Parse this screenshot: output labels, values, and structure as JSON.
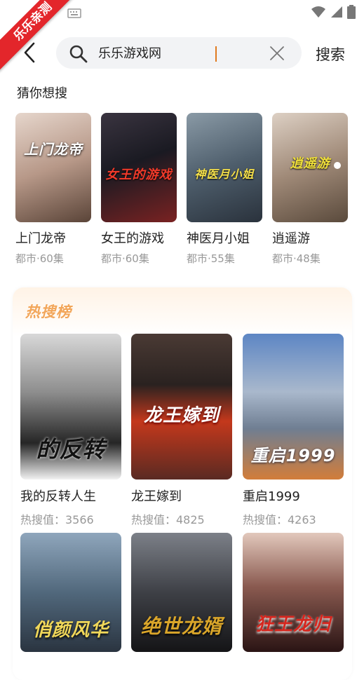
{
  "statusbar": {
    "ribbon_text": "乐乐亲测"
  },
  "search": {
    "value": "乐乐游戏网",
    "button_label": "搜索"
  },
  "guess": {
    "title": "猜你想搜",
    "items": [
      {
        "name": "上门龙帝",
        "meta": "都市·60集",
        "poster_text": "上门龙帝",
        "colors": [
          "#d9c8c0",
          "#7a5a4a"
        ]
      },
      {
        "name": "女王的游戏",
        "meta": "都市·60集",
        "poster_text": "女王的游戏",
        "colors": [
          "#1f1f2a",
          "#8a2a2a"
        ]
      },
      {
        "name": "神医月小姐",
        "meta": "都市·55集",
        "poster_text": "神医月小姐",
        "colors": [
          "#5c6e7c",
          "#2b3540"
        ]
      },
      {
        "name": "逍遥游",
        "meta": "都市·48集",
        "poster_text": "逍遥游",
        "colors": [
          "#c8b8a8",
          "#6d5a4a"
        ]
      }
    ]
  },
  "hot": {
    "title": "热搜榜",
    "items": [
      {
        "name": "我的反转人生",
        "meta": "热搜值：3566",
        "poster_text": "的反转",
        "colors": [
          "#bdbdbd",
          "#2a2a2a"
        ]
      },
      {
        "name": "龙王嫁到",
        "meta": "热搜值：4825",
        "poster_text": "龙王嫁到",
        "colors": [
          "#3a2a26",
          "#c0391e"
        ]
      },
      {
        "name": "重启1999",
        "meta": "热搜值：4263",
        "poster_text": "重启1999",
        "colors": [
          "#6b8fc2",
          "#c87a3a"
        ]
      }
    ],
    "more": [
      {
        "poster_text": "俏颜风华",
        "colors": [
          "#6e8aa6",
          "#2a3a4a"
        ]
      },
      {
        "poster_text": "绝世龙婿",
        "colors": [
          "#5a5c60",
          "#1c1c1e"
        ]
      },
      {
        "poster_text": "狂王龙归",
        "colors": [
          "#c89a8a",
          "#3a1a1a"
        ]
      }
    ]
  }
}
